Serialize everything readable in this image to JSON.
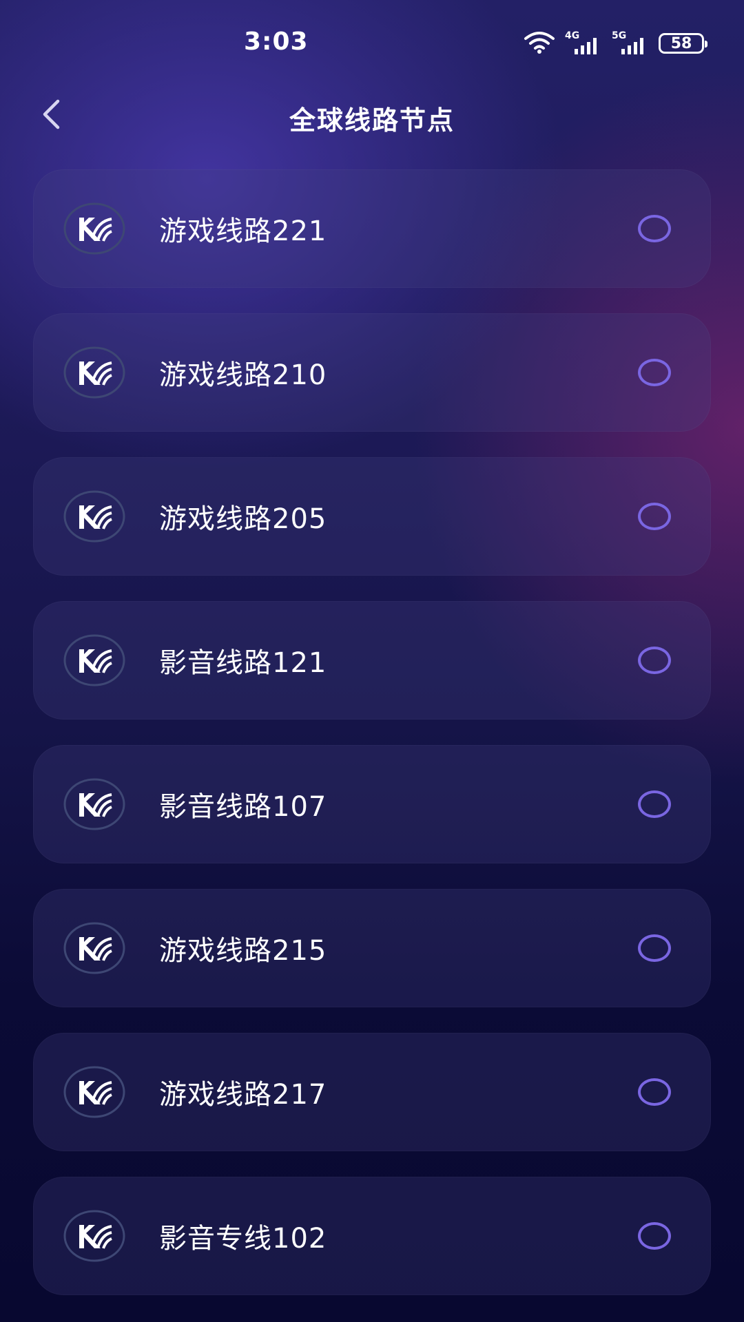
{
  "status_bar": {
    "time": "3:03",
    "network_1": "4G",
    "network_2": "5G",
    "battery": "58",
    "icons": [
      "wifi-icon",
      "signal-4g-icon",
      "signal-5g-icon",
      "battery-icon"
    ]
  },
  "header": {
    "back_icon": "chevron-left-icon",
    "title": "全球线路节点"
  },
  "nodes": [
    {
      "name": "游戏线路221",
      "selected": false
    },
    {
      "name": "游戏线路210",
      "selected": false
    },
    {
      "name": "游戏线路205",
      "selected": false
    },
    {
      "name": "影音线路121",
      "selected": false
    },
    {
      "name": "影音线路107",
      "selected": false
    },
    {
      "name": "游戏线路215",
      "selected": false
    },
    {
      "name": "游戏线路217",
      "selected": false
    },
    {
      "name": "影音专线102",
      "selected": false
    }
  ],
  "colors": {
    "accent": "#7a66e2",
    "background_top": "#232066",
    "background_bottom": "#080830",
    "card": "#2a2760"
  }
}
